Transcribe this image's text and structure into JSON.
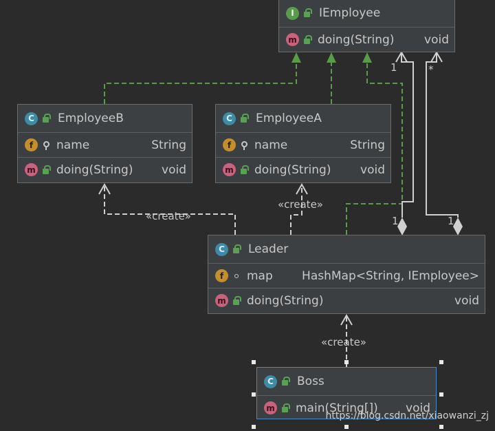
{
  "classes": {
    "iemployee": {
      "name": "IEmployee",
      "kind": "interface",
      "methods": [
        {
          "name": "doing(String)",
          "type": "void"
        }
      ]
    },
    "employeeB": {
      "name": "EmployeeB",
      "kind": "class",
      "fields": [
        {
          "name": "name",
          "type": "String"
        }
      ],
      "methods": [
        {
          "name": "doing(String)",
          "type": "void"
        }
      ]
    },
    "employeeA": {
      "name": "EmployeeA",
      "kind": "class",
      "fields": [
        {
          "name": "name",
          "type": "String"
        }
      ],
      "methods": [
        {
          "name": "doing(String)",
          "type": "void"
        }
      ]
    },
    "leader": {
      "name": "Leader",
      "kind": "class",
      "fields": [
        {
          "name": "map",
          "type": "HashMap<String, IEmployee>"
        }
      ],
      "methods": [
        {
          "name": "doing(String)",
          "type": "void"
        }
      ]
    },
    "boss": {
      "name": "Boss",
      "kind": "class",
      "methods": [
        {
          "name": "main(String[])",
          "type": "void"
        }
      ]
    }
  },
  "badges": {
    "class": "C",
    "interface": "I",
    "field": "f",
    "method": "m"
  },
  "edge_labels": {
    "create_b": "«create»",
    "create_a": "«create»",
    "create_leader": "«create»",
    "mult_top_1": "1",
    "mult_top_star": "*",
    "mult_leader_1a": "1",
    "mult_leader_1b": "1"
  },
  "watermark": "https://blog.csdn.net/xiaowanzi_zj",
  "colors": {
    "background": "#2b2b2b",
    "implements_edge": "#5a9b4a",
    "association_edge": "#d0d0d0",
    "selection": "#4a88c7"
  }
}
